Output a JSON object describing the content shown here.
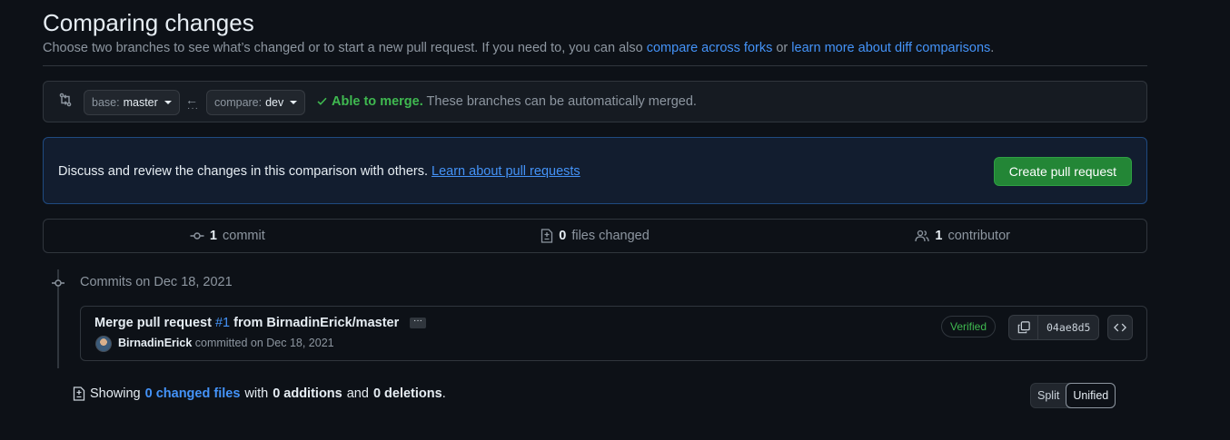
{
  "header": {
    "title": "Comparing changes",
    "subtitle_prefix": "Choose two branches to see what’s changed or to start a new pull request. If you need to, you can also ",
    "link_forks": "compare across forks",
    "subtitle_or": " or ",
    "link_learn": "learn more about diff comparisons",
    "subtitle_end": "."
  },
  "range": {
    "base_label": "base:",
    "base_value": "master",
    "compare_label": "compare:",
    "compare_value": "dev",
    "arrow": "←",
    "dots": "···",
    "merge_ok": "Able to merge.",
    "merge_text": " These branches can be automatically merged."
  },
  "flash": {
    "text": "Discuss and review the changes in this comparison with others. ",
    "link": "Learn about pull requests",
    "button": "Create pull request"
  },
  "summary": {
    "commits_count": "1",
    "commits_label": "commit",
    "files_count": "0",
    "files_label": "files changed",
    "contributors_count": "1",
    "contributors_label": "contributor"
  },
  "commits": {
    "group_heading": "Commits on Dec 18, 2021",
    "items": [
      {
        "message_prefix": "Merge pull request ",
        "pr_ref": "#1",
        "message_suffix": " from BirnadinErick/master",
        "ellipsis": "···",
        "author": "BirnadinErick",
        "committed": " committed on Dec 18, 2021",
        "verified": "Verified",
        "sha": "04ae8d5"
      }
    ]
  },
  "footer": {
    "showing": "Showing",
    "changed_files": "0 changed files",
    "with": "with",
    "additions": "0 additions",
    "and": "and",
    "deletions": "0 deletions",
    "period": ".",
    "split": "Split",
    "unified": "Unified"
  },
  "colors": {
    "background": "#0d1117",
    "accent_link": "#4493f8",
    "success": "#3fb950",
    "primary_button": "#238636"
  }
}
